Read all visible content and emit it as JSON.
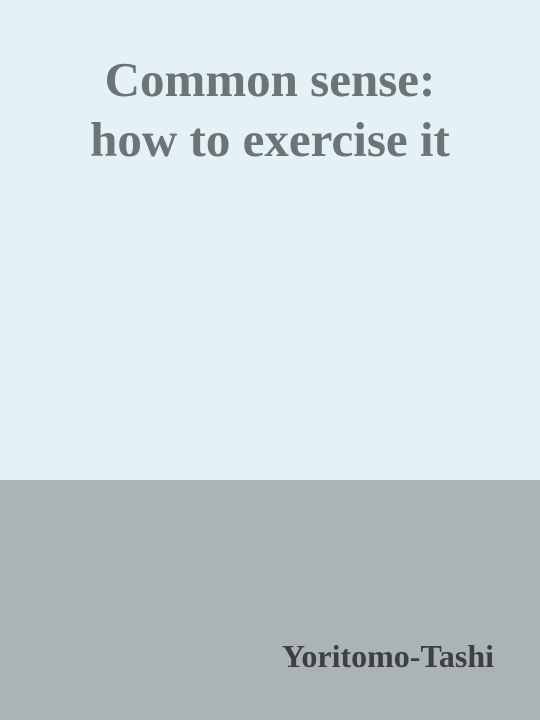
{
  "cover": {
    "title_lines": [
      "Common sense:",
      "how to exercise it"
    ],
    "author": "Yoritomo-Tashi",
    "colors": {
      "top_background": "#e4f1f6",
      "bottom_background": "#abb3b6",
      "title_text": "#6c7475",
      "author_text": "#3b4043"
    }
  }
}
